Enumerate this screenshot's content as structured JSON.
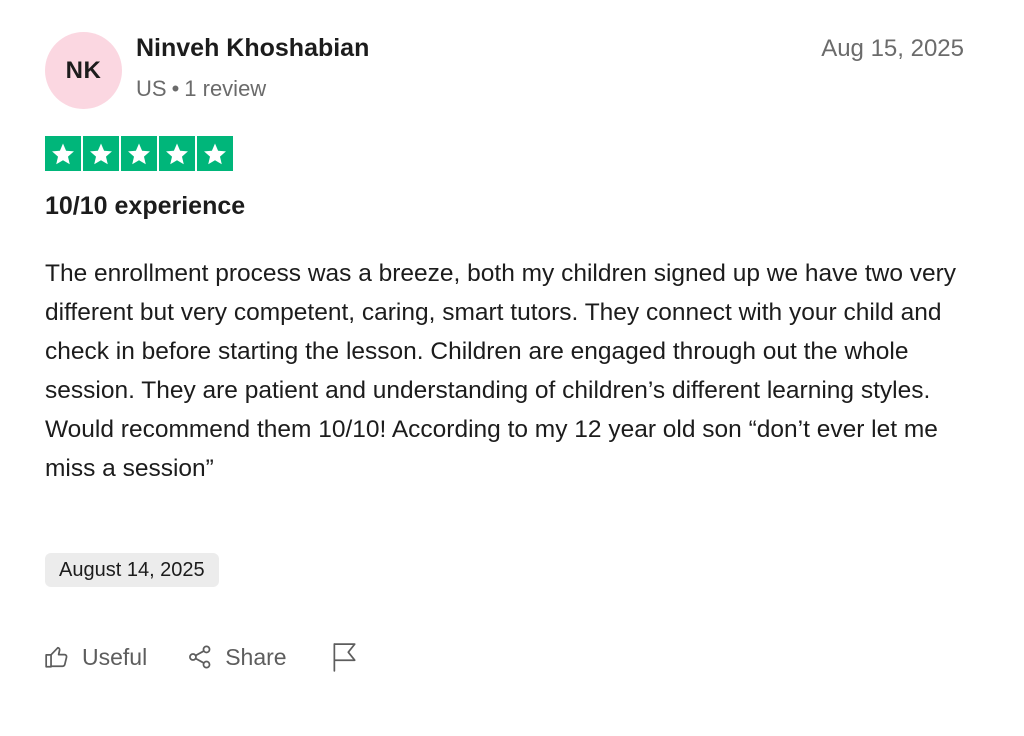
{
  "author": {
    "initials": "NK",
    "avatar_color": "#fbd7e1",
    "name": "Ninveh Khoshabian",
    "country": "US",
    "separator": "•",
    "review_count": "1 review"
  },
  "review": {
    "posted_date": "Aug 15, 2025",
    "rating": 5,
    "rating_max": 5,
    "star_color": "#00b67a",
    "title": "10/10 experience",
    "body": "The enrollment process was a breeze, both my children signed up we have two very different but very competent, caring, smart tutors. They connect with your child and check in before starting the lesson. Children are engaged through out the whole session. They are patient and understanding of children’s different learning styles. Would recommend them 10/10! According to my 12 year old son “don’t ever let me miss a session”",
    "experience_date": "August 14, 2025"
  },
  "actions": {
    "useful_label": "Useful",
    "useful_icon": "thumbs-up-icon",
    "share_label": "Share",
    "share_icon": "share-icon",
    "report_icon": "flag-icon"
  }
}
